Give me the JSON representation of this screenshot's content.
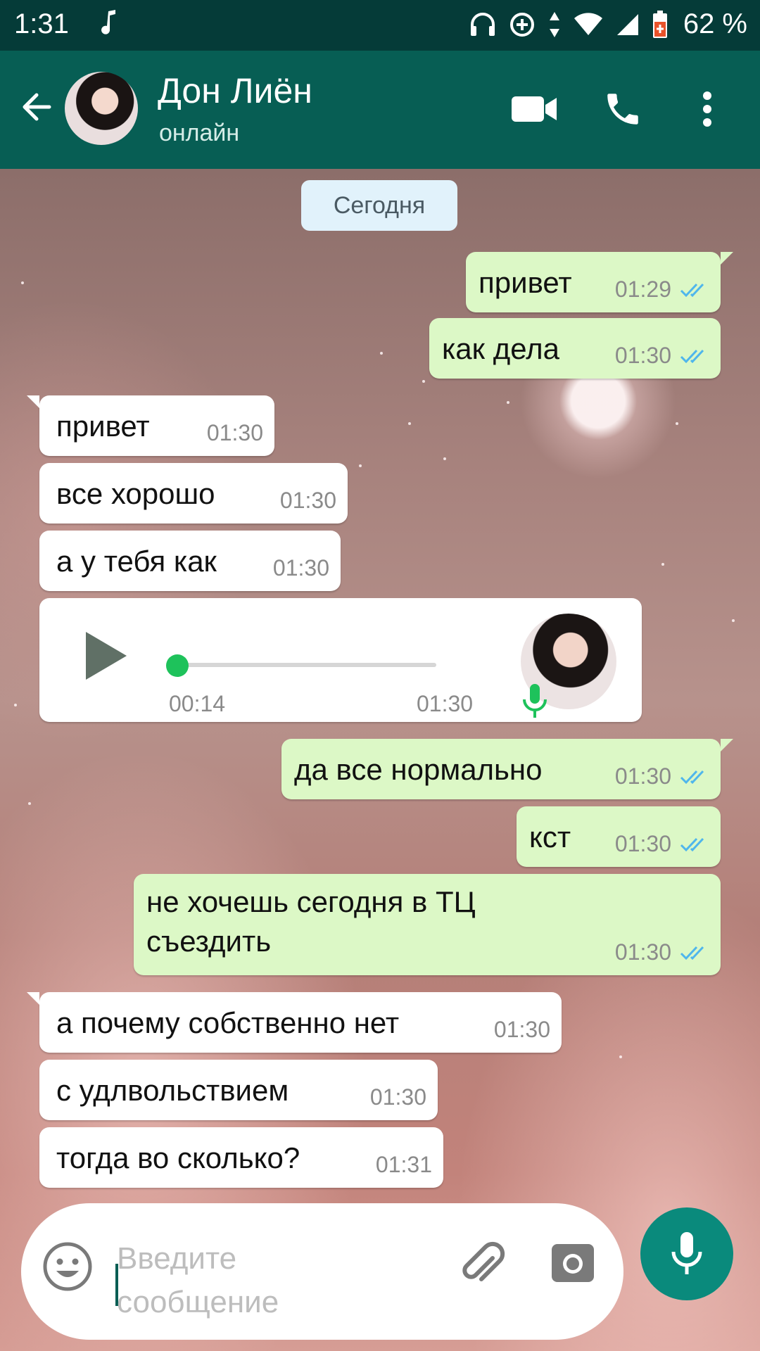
{
  "status_bar": {
    "time": "1:31",
    "battery": "62 %"
  },
  "header": {
    "contact_name": "Дон Лиён",
    "contact_status": "онлайн"
  },
  "chat": {
    "date_label": "Сегодня",
    "messages": [
      {
        "direction": "out",
        "text": "привет",
        "time": "01:29",
        "read": true
      },
      {
        "direction": "out",
        "text": "как дела",
        "time": "01:30",
        "read": true
      },
      {
        "direction": "in",
        "text": "привет",
        "time": "01:30"
      },
      {
        "direction": "in",
        "text": "все хорошо",
        "time": "01:30"
      },
      {
        "direction": "in",
        "text": "а у тебя как",
        "time": "01:30"
      },
      {
        "direction": "in",
        "type": "voice",
        "duration": "00:14",
        "time": "01:30",
        "progress": 0
      },
      {
        "direction": "out",
        "text": "да все нормально",
        "time": "01:30",
        "read": true
      },
      {
        "direction": "out",
        "text": "кст",
        "time": "01:30",
        "read": true
      },
      {
        "direction": "out",
        "text": "не хочешь сегодня в ТЦ съездить",
        "time": "01:30",
        "read": true
      },
      {
        "direction": "in",
        "text": "а почему собственно нет",
        "time": "01:30"
      },
      {
        "direction": "in",
        "text": "с удлвольствием",
        "time": "01:30"
      },
      {
        "direction": "in",
        "text": "тогда во сколько?",
        "time": "01:31"
      }
    ]
  },
  "composer": {
    "placeholder": "Введите сообщение"
  },
  "colors": {
    "header": "#075e54",
    "status_bar": "#053b38",
    "outgoing_bubble": "#dcf8c6",
    "incoming_bubble": "#ffffff",
    "read_ticks": "#4fb6ec",
    "accent_green": "#1ec25b",
    "mic_button": "#0a8a7c"
  },
  "icons": [
    "music-note-icon",
    "headphones-icon",
    "data-saver-icon",
    "data-arrows-icon",
    "wifi-icon",
    "signal-icon",
    "battery-icon",
    "back-arrow-icon",
    "video-call-icon",
    "phone-icon",
    "more-vert-icon",
    "play-icon",
    "mic-icon",
    "emoji-icon",
    "attach-icon",
    "camera-icon"
  ]
}
